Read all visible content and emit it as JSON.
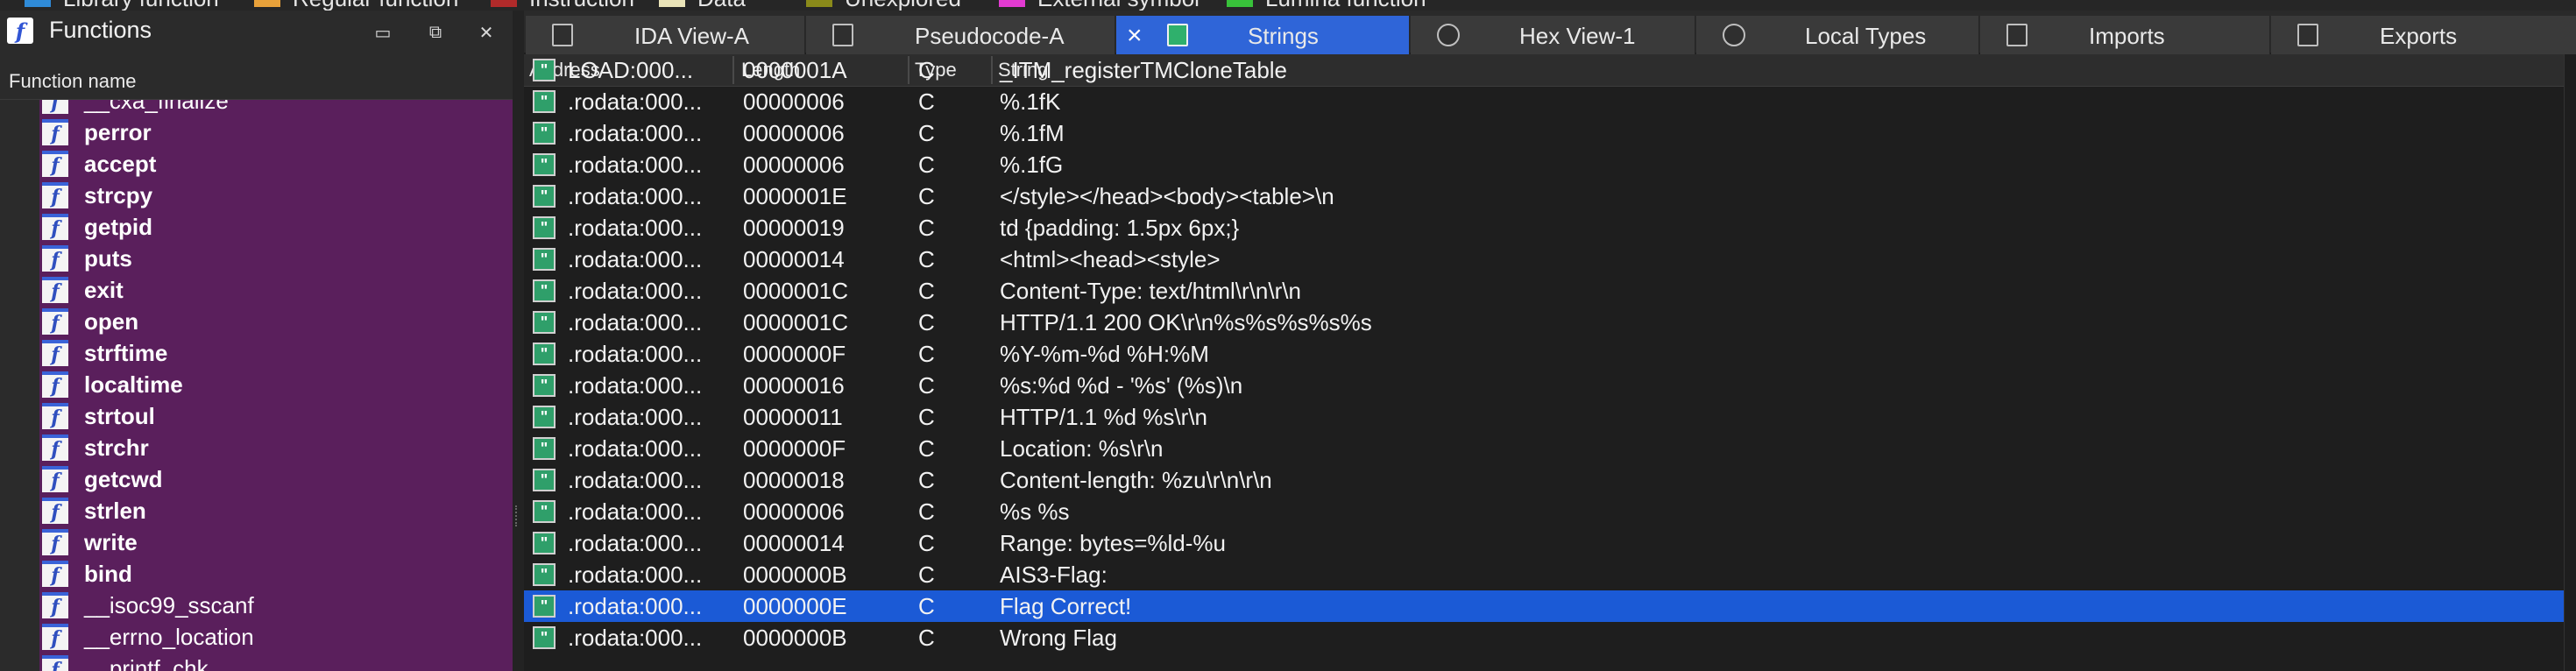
{
  "legend": [
    {
      "label": "Library function",
      "color": "#2f8bd8"
    },
    {
      "label": "Regular function",
      "color": "#e8a13a"
    },
    {
      "label": "Instruction",
      "color": "#b02a2a"
    },
    {
      "label": "Data",
      "color": "#e9e3b8"
    },
    {
      "label": "Unexplored",
      "color": "#8a8a1a"
    },
    {
      "label": "External symbol",
      "color": "#e23ad1"
    },
    {
      "label": "Lumina function",
      "color": "#38c13a"
    }
  ],
  "functions_window": {
    "title": "Functions",
    "column_header": "Function name",
    "items": [
      "__cxa_finalize",
      "perror",
      "accept",
      "strcpy",
      "getpid",
      "puts",
      "exit",
      "open",
      "strftime",
      "localtime",
      "strtoul",
      "strchr",
      "getcwd",
      "strlen",
      "write",
      "bind",
      "__isoc99_sscanf",
      "__errno_location",
      "__printf_chk"
    ]
  },
  "tabs": [
    {
      "label": "IDA View-A",
      "active": false
    },
    {
      "label": "Pseudocode-A",
      "active": false
    },
    {
      "label": "Strings",
      "active": true
    },
    {
      "label": "Hex View-1",
      "active": false
    },
    {
      "label": "Local Types",
      "active": false
    },
    {
      "label": "Imports",
      "active": false
    },
    {
      "label": "Exports",
      "active": false
    }
  ],
  "strings_table": {
    "columns": [
      "Address",
      "Length",
      "Type",
      "String"
    ],
    "rows": [
      {
        "address": "LOAD:000...",
        "length": "0000001A",
        "type": "C",
        "string": "_ITM_registerTMCloneTable"
      },
      {
        "address": ".rodata:000...",
        "length": "00000006",
        "type": "C",
        "string": "%.1fK"
      },
      {
        "address": ".rodata:000...",
        "length": "00000006",
        "type": "C",
        "string": "%.1fM"
      },
      {
        "address": ".rodata:000...",
        "length": "00000006",
        "type": "C",
        "string": "%.1fG"
      },
      {
        "address": ".rodata:000...",
        "length": "0000001E",
        "type": "C",
        "string": "</style></head><body><table>\\n"
      },
      {
        "address": ".rodata:000...",
        "length": "00000019",
        "type": "C",
        "string": "td {padding: 1.5px 6px;}"
      },
      {
        "address": ".rodata:000...",
        "length": "00000014",
        "type": "C",
        "string": "<html><head><style>"
      },
      {
        "address": ".rodata:000...",
        "length": "0000001C",
        "type": "C",
        "string": "Content-Type: text/html\\r\\n\\r\\n"
      },
      {
        "address": ".rodata:000...",
        "length": "0000001C",
        "type": "C",
        "string": "HTTP/1.1 200 OK\\r\\n%s%s%s%s%s"
      },
      {
        "address": ".rodata:000...",
        "length": "0000000F",
        "type": "C",
        "string": "%Y-%m-%d %H:%M"
      },
      {
        "address": ".rodata:000...",
        "length": "00000016",
        "type": "C",
        "string": "%s:%d %d - '%s' (%s)\\n"
      },
      {
        "address": ".rodata:000...",
        "length": "00000011",
        "type": "C",
        "string": "HTTP/1.1 %d %s\\r\\n"
      },
      {
        "address": ".rodata:000...",
        "length": "0000000F",
        "type": "C",
        "string": "Location: %s\\r\\n"
      },
      {
        "address": ".rodata:000...",
        "length": "00000018",
        "type": "C",
        "string": "Content-length: %zu\\r\\n\\r\\n"
      },
      {
        "address": ".rodata:000...",
        "length": "00000006",
        "type": "C",
        "string": "%s %s"
      },
      {
        "address": ".rodata:000...",
        "length": "00000014",
        "type": "C",
        "string": "Range: bytes=%ld-%u"
      },
      {
        "address": ".rodata:000...",
        "length": "0000000B",
        "type": "C",
        "string": "AIS3-Flag:"
      },
      {
        "address": ".rodata:000...",
        "length": "0000000E",
        "type": "C",
        "string": "Flag Correct!",
        "selected": true
      },
      {
        "address": ".rodata:000...",
        "length": "0000000B",
        "type": "C",
        "string": "Wrong Flag"
      }
    ]
  }
}
